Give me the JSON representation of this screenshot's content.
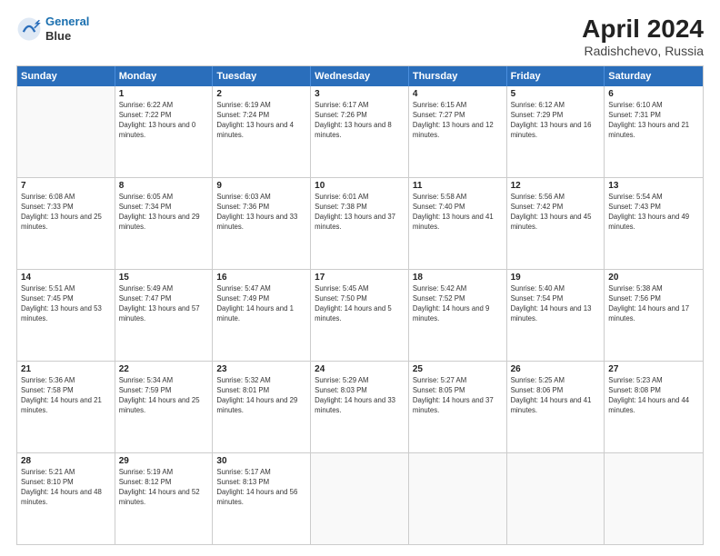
{
  "header": {
    "logo_line1": "General",
    "logo_line2": "Blue",
    "title": "April 2024",
    "subtitle": "Radishchevo, Russia"
  },
  "calendar": {
    "days_of_week": [
      "Sunday",
      "Monday",
      "Tuesday",
      "Wednesday",
      "Thursday",
      "Friday",
      "Saturday"
    ],
    "rows": [
      [
        {
          "day": "",
          "empty": true
        },
        {
          "day": "1",
          "sunrise": "Sunrise: 6:22 AM",
          "sunset": "Sunset: 7:22 PM",
          "daylight": "Daylight: 13 hours and 0 minutes."
        },
        {
          "day": "2",
          "sunrise": "Sunrise: 6:19 AM",
          "sunset": "Sunset: 7:24 PM",
          "daylight": "Daylight: 13 hours and 4 minutes."
        },
        {
          "day": "3",
          "sunrise": "Sunrise: 6:17 AM",
          "sunset": "Sunset: 7:26 PM",
          "daylight": "Daylight: 13 hours and 8 minutes."
        },
        {
          "day": "4",
          "sunrise": "Sunrise: 6:15 AM",
          "sunset": "Sunset: 7:27 PM",
          "daylight": "Daylight: 13 hours and 12 minutes."
        },
        {
          "day": "5",
          "sunrise": "Sunrise: 6:12 AM",
          "sunset": "Sunset: 7:29 PM",
          "daylight": "Daylight: 13 hours and 16 minutes."
        },
        {
          "day": "6",
          "sunrise": "Sunrise: 6:10 AM",
          "sunset": "Sunset: 7:31 PM",
          "daylight": "Daylight: 13 hours and 21 minutes."
        }
      ],
      [
        {
          "day": "7",
          "sunrise": "Sunrise: 6:08 AM",
          "sunset": "Sunset: 7:33 PM",
          "daylight": "Daylight: 13 hours and 25 minutes."
        },
        {
          "day": "8",
          "sunrise": "Sunrise: 6:05 AM",
          "sunset": "Sunset: 7:34 PM",
          "daylight": "Daylight: 13 hours and 29 minutes."
        },
        {
          "day": "9",
          "sunrise": "Sunrise: 6:03 AM",
          "sunset": "Sunset: 7:36 PM",
          "daylight": "Daylight: 13 hours and 33 minutes."
        },
        {
          "day": "10",
          "sunrise": "Sunrise: 6:01 AM",
          "sunset": "Sunset: 7:38 PM",
          "daylight": "Daylight: 13 hours and 37 minutes."
        },
        {
          "day": "11",
          "sunrise": "Sunrise: 5:58 AM",
          "sunset": "Sunset: 7:40 PM",
          "daylight": "Daylight: 13 hours and 41 minutes."
        },
        {
          "day": "12",
          "sunrise": "Sunrise: 5:56 AM",
          "sunset": "Sunset: 7:42 PM",
          "daylight": "Daylight: 13 hours and 45 minutes."
        },
        {
          "day": "13",
          "sunrise": "Sunrise: 5:54 AM",
          "sunset": "Sunset: 7:43 PM",
          "daylight": "Daylight: 13 hours and 49 minutes."
        }
      ],
      [
        {
          "day": "14",
          "sunrise": "Sunrise: 5:51 AM",
          "sunset": "Sunset: 7:45 PM",
          "daylight": "Daylight: 13 hours and 53 minutes."
        },
        {
          "day": "15",
          "sunrise": "Sunrise: 5:49 AM",
          "sunset": "Sunset: 7:47 PM",
          "daylight": "Daylight: 13 hours and 57 minutes."
        },
        {
          "day": "16",
          "sunrise": "Sunrise: 5:47 AM",
          "sunset": "Sunset: 7:49 PM",
          "daylight": "Daylight: 14 hours and 1 minute."
        },
        {
          "day": "17",
          "sunrise": "Sunrise: 5:45 AM",
          "sunset": "Sunset: 7:50 PM",
          "daylight": "Daylight: 14 hours and 5 minutes."
        },
        {
          "day": "18",
          "sunrise": "Sunrise: 5:42 AM",
          "sunset": "Sunset: 7:52 PM",
          "daylight": "Daylight: 14 hours and 9 minutes."
        },
        {
          "day": "19",
          "sunrise": "Sunrise: 5:40 AM",
          "sunset": "Sunset: 7:54 PM",
          "daylight": "Daylight: 14 hours and 13 minutes."
        },
        {
          "day": "20",
          "sunrise": "Sunrise: 5:38 AM",
          "sunset": "Sunset: 7:56 PM",
          "daylight": "Daylight: 14 hours and 17 minutes."
        }
      ],
      [
        {
          "day": "21",
          "sunrise": "Sunrise: 5:36 AM",
          "sunset": "Sunset: 7:58 PM",
          "daylight": "Daylight: 14 hours and 21 minutes."
        },
        {
          "day": "22",
          "sunrise": "Sunrise: 5:34 AM",
          "sunset": "Sunset: 7:59 PM",
          "daylight": "Daylight: 14 hours and 25 minutes."
        },
        {
          "day": "23",
          "sunrise": "Sunrise: 5:32 AM",
          "sunset": "Sunset: 8:01 PM",
          "daylight": "Daylight: 14 hours and 29 minutes."
        },
        {
          "day": "24",
          "sunrise": "Sunrise: 5:29 AM",
          "sunset": "Sunset: 8:03 PM",
          "daylight": "Daylight: 14 hours and 33 minutes."
        },
        {
          "day": "25",
          "sunrise": "Sunrise: 5:27 AM",
          "sunset": "Sunset: 8:05 PM",
          "daylight": "Daylight: 14 hours and 37 minutes."
        },
        {
          "day": "26",
          "sunrise": "Sunrise: 5:25 AM",
          "sunset": "Sunset: 8:06 PM",
          "daylight": "Daylight: 14 hours and 41 minutes."
        },
        {
          "day": "27",
          "sunrise": "Sunrise: 5:23 AM",
          "sunset": "Sunset: 8:08 PM",
          "daylight": "Daylight: 14 hours and 44 minutes."
        }
      ],
      [
        {
          "day": "28",
          "sunrise": "Sunrise: 5:21 AM",
          "sunset": "Sunset: 8:10 PM",
          "daylight": "Daylight: 14 hours and 48 minutes."
        },
        {
          "day": "29",
          "sunrise": "Sunrise: 5:19 AM",
          "sunset": "Sunset: 8:12 PM",
          "daylight": "Daylight: 14 hours and 52 minutes."
        },
        {
          "day": "30",
          "sunrise": "Sunrise: 5:17 AM",
          "sunset": "Sunset: 8:13 PM",
          "daylight": "Daylight: 14 hours and 56 minutes."
        },
        {
          "day": "",
          "empty": true
        },
        {
          "day": "",
          "empty": true
        },
        {
          "day": "",
          "empty": true
        },
        {
          "day": "",
          "empty": true
        }
      ]
    ]
  }
}
